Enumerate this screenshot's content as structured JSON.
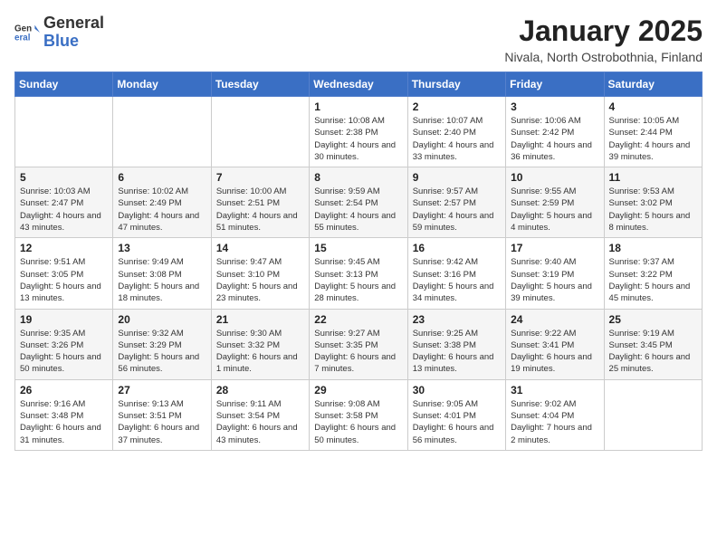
{
  "logo": {
    "general": "General",
    "blue": "Blue"
  },
  "header": {
    "month": "January 2025",
    "location": "Nivala, North Ostrobothnia, Finland"
  },
  "weekdays": [
    "Sunday",
    "Monday",
    "Tuesday",
    "Wednesday",
    "Thursday",
    "Friday",
    "Saturday"
  ],
  "weeks": [
    [
      {
        "day": "",
        "sunrise": "",
        "sunset": "",
        "daylight": ""
      },
      {
        "day": "",
        "sunrise": "",
        "sunset": "",
        "daylight": ""
      },
      {
        "day": "",
        "sunrise": "",
        "sunset": "",
        "daylight": ""
      },
      {
        "day": "1",
        "sunrise": "Sunrise: 10:08 AM",
        "sunset": "Sunset: 2:38 PM",
        "daylight": "Daylight: 4 hours and 30 minutes."
      },
      {
        "day": "2",
        "sunrise": "Sunrise: 10:07 AM",
        "sunset": "Sunset: 2:40 PM",
        "daylight": "Daylight: 4 hours and 33 minutes."
      },
      {
        "day": "3",
        "sunrise": "Sunrise: 10:06 AM",
        "sunset": "Sunset: 2:42 PM",
        "daylight": "Daylight: 4 hours and 36 minutes."
      },
      {
        "day": "4",
        "sunrise": "Sunrise: 10:05 AM",
        "sunset": "Sunset: 2:44 PM",
        "daylight": "Daylight: 4 hours and 39 minutes."
      }
    ],
    [
      {
        "day": "5",
        "sunrise": "Sunrise: 10:03 AM",
        "sunset": "Sunset: 2:47 PM",
        "daylight": "Daylight: 4 hours and 43 minutes."
      },
      {
        "day": "6",
        "sunrise": "Sunrise: 10:02 AM",
        "sunset": "Sunset: 2:49 PM",
        "daylight": "Daylight: 4 hours and 47 minutes."
      },
      {
        "day": "7",
        "sunrise": "Sunrise: 10:00 AM",
        "sunset": "Sunset: 2:51 PM",
        "daylight": "Daylight: 4 hours and 51 minutes."
      },
      {
        "day": "8",
        "sunrise": "Sunrise: 9:59 AM",
        "sunset": "Sunset: 2:54 PM",
        "daylight": "Daylight: 4 hours and 55 minutes."
      },
      {
        "day": "9",
        "sunrise": "Sunrise: 9:57 AM",
        "sunset": "Sunset: 2:57 PM",
        "daylight": "Daylight: 4 hours and 59 minutes."
      },
      {
        "day": "10",
        "sunrise": "Sunrise: 9:55 AM",
        "sunset": "Sunset: 2:59 PM",
        "daylight": "Daylight: 5 hours and 4 minutes."
      },
      {
        "day": "11",
        "sunrise": "Sunrise: 9:53 AM",
        "sunset": "Sunset: 3:02 PM",
        "daylight": "Daylight: 5 hours and 8 minutes."
      }
    ],
    [
      {
        "day": "12",
        "sunrise": "Sunrise: 9:51 AM",
        "sunset": "Sunset: 3:05 PM",
        "daylight": "Daylight: 5 hours and 13 minutes."
      },
      {
        "day": "13",
        "sunrise": "Sunrise: 9:49 AM",
        "sunset": "Sunset: 3:08 PM",
        "daylight": "Daylight: 5 hours and 18 minutes."
      },
      {
        "day": "14",
        "sunrise": "Sunrise: 9:47 AM",
        "sunset": "Sunset: 3:10 PM",
        "daylight": "Daylight: 5 hours and 23 minutes."
      },
      {
        "day": "15",
        "sunrise": "Sunrise: 9:45 AM",
        "sunset": "Sunset: 3:13 PM",
        "daylight": "Daylight: 5 hours and 28 minutes."
      },
      {
        "day": "16",
        "sunrise": "Sunrise: 9:42 AM",
        "sunset": "Sunset: 3:16 PM",
        "daylight": "Daylight: 5 hours and 34 minutes."
      },
      {
        "day": "17",
        "sunrise": "Sunrise: 9:40 AM",
        "sunset": "Sunset: 3:19 PM",
        "daylight": "Daylight: 5 hours and 39 minutes."
      },
      {
        "day": "18",
        "sunrise": "Sunrise: 9:37 AM",
        "sunset": "Sunset: 3:22 PM",
        "daylight": "Daylight: 5 hours and 45 minutes."
      }
    ],
    [
      {
        "day": "19",
        "sunrise": "Sunrise: 9:35 AM",
        "sunset": "Sunset: 3:26 PM",
        "daylight": "Daylight: 5 hours and 50 minutes."
      },
      {
        "day": "20",
        "sunrise": "Sunrise: 9:32 AM",
        "sunset": "Sunset: 3:29 PM",
        "daylight": "Daylight: 5 hours and 56 minutes."
      },
      {
        "day": "21",
        "sunrise": "Sunrise: 9:30 AM",
        "sunset": "Sunset: 3:32 PM",
        "daylight": "Daylight: 6 hours and 1 minute."
      },
      {
        "day": "22",
        "sunrise": "Sunrise: 9:27 AM",
        "sunset": "Sunset: 3:35 PM",
        "daylight": "Daylight: 6 hours and 7 minutes."
      },
      {
        "day": "23",
        "sunrise": "Sunrise: 9:25 AM",
        "sunset": "Sunset: 3:38 PM",
        "daylight": "Daylight: 6 hours and 13 minutes."
      },
      {
        "day": "24",
        "sunrise": "Sunrise: 9:22 AM",
        "sunset": "Sunset: 3:41 PM",
        "daylight": "Daylight: 6 hours and 19 minutes."
      },
      {
        "day": "25",
        "sunrise": "Sunrise: 9:19 AM",
        "sunset": "Sunset: 3:45 PM",
        "daylight": "Daylight: 6 hours and 25 minutes."
      }
    ],
    [
      {
        "day": "26",
        "sunrise": "Sunrise: 9:16 AM",
        "sunset": "Sunset: 3:48 PM",
        "daylight": "Daylight: 6 hours and 31 minutes."
      },
      {
        "day": "27",
        "sunrise": "Sunrise: 9:13 AM",
        "sunset": "Sunset: 3:51 PM",
        "daylight": "Daylight: 6 hours and 37 minutes."
      },
      {
        "day": "28",
        "sunrise": "Sunrise: 9:11 AM",
        "sunset": "Sunset: 3:54 PM",
        "daylight": "Daylight: 6 hours and 43 minutes."
      },
      {
        "day": "29",
        "sunrise": "Sunrise: 9:08 AM",
        "sunset": "Sunset: 3:58 PM",
        "daylight": "Daylight: 6 hours and 50 minutes."
      },
      {
        "day": "30",
        "sunrise": "Sunrise: 9:05 AM",
        "sunset": "Sunset: 4:01 PM",
        "daylight": "Daylight: 6 hours and 56 minutes."
      },
      {
        "day": "31",
        "sunrise": "Sunrise: 9:02 AM",
        "sunset": "Sunset: 4:04 PM",
        "daylight": "Daylight: 7 hours and 2 minutes."
      },
      {
        "day": "",
        "sunrise": "",
        "sunset": "",
        "daylight": ""
      }
    ]
  ]
}
